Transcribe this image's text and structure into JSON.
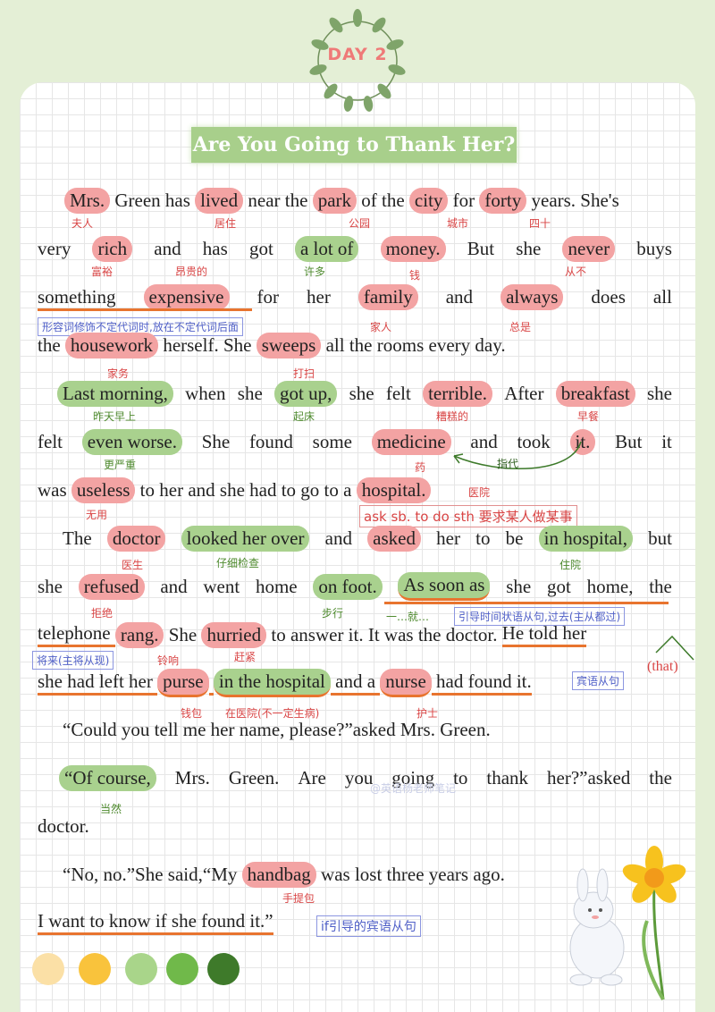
{
  "header": {
    "day": "DAY 2",
    "title": "Are You Going to Thank Her?"
  },
  "paragraphs": {
    "p1": {
      "l1": [
        "Mrs.",
        " Green has ",
        "lived",
        " near the ",
        "park",
        " of the ",
        "city",
        " for ",
        "forty",
        " years. She's"
      ],
      "l2": [
        "very",
        "rich",
        "and",
        "has",
        "got",
        "a lot of",
        "money.",
        "But",
        "she",
        "never",
        "buys"
      ],
      "l3": [
        "something",
        "expensive",
        "for",
        "her",
        "family",
        "and",
        "always",
        "does",
        "all"
      ],
      "l4": [
        "the ",
        "housework",
        " herself. She ",
        "sweeps",
        " all the rooms every day."
      ]
    },
    "p2": {
      "l1": [
        "Last morning,",
        "when",
        "she",
        "got up,",
        "she",
        "felt",
        "terrible.",
        "After",
        "breakfast",
        "she"
      ],
      "l2": [
        "felt",
        "even worse.",
        "She",
        "found",
        "some",
        "medicine",
        "and",
        "took",
        "it.",
        "But",
        "it"
      ],
      "l3": [
        "was ",
        "useless",
        " to her and she had to go to a ",
        "hospital."
      ]
    },
    "p3": {
      "l1": [
        "The",
        "doctor",
        "looked her over",
        "and",
        "asked",
        "her",
        "to",
        "be",
        "in hospital,",
        "but"
      ],
      "l2": [
        "she",
        "refused",
        "and",
        "went",
        "home",
        "on foot.",
        "As soon as",
        "she",
        "got",
        "home,",
        "the"
      ],
      "l3": [
        "telephone ",
        "rang.",
        " She ",
        "hurried",
        " to answer it. It was the doctor. ",
        "He told her"
      ],
      "l4": [
        "she had left her ",
        "purse",
        " ",
        "in the hospital",
        " and a ",
        "nurse",
        " had found it."
      ]
    },
    "p4": {
      "l1": "“Could you tell me her name, please?”asked Mrs. Green."
    },
    "p5": {
      "l1": [
        "“Of course,",
        "Mrs.",
        "Green.",
        "Are",
        "you",
        "going",
        "to",
        "thank",
        "her?”asked",
        "the"
      ],
      "l2": "doctor."
    },
    "p6": {
      "l1": [
        "“No, no.”She said,“My ",
        "handbag",
        " was lost three years ago."
      ],
      "l2": "I want to know if she found it.”"
    }
  },
  "notes": {
    "mrs": "夫人",
    "lived": "居住",
    "park": "公园",
    "city": "城市",
    "forty": "四十",
    "rich": "富裕",
    "expensive": "昂贵的",
    "alotof": "许多",
    "money": "钱",
    "never": "从不",
    "family": "家人",
    "always": "总是",
    "housework": "家务",
    "sweeps": "打扫",
    "last_morning": "昨天早上",
    "got_up": "起床",
    "terrible": "糟糕的",
    "breakfast": "早餐",
    "even_worse": "更严重",
    "medicine": "药",
    "refer": "指代",
    "useless": "无用",
    "hospital": "医院",
    "doctor": "医生",
    "looked_over": "仔细检查",
    "in_hospital": "住院",
    "refused": "拒绝",
    "on_foot": "步行",
    "as_soon_as": "一…就…",
    "rang": "铃响",
    "hurried": "赶紧",
    "purse": "钱包",
    "in_the_hospital": "在医院(不一定生病)",
    "nurse": "护士",
    "of_course": "当然",
    "handbag": "手提包"
  },
  "boxes": {
    "adj_rule": "形容词修饰不定代词时,放在不定代词后面",
    "ask_sb": "ask sb. to do sth 要求某人做某事",
    "time_clause": "引导时间状语从句,过去(主从都过)",
    "future": "将来(主将从现)",
    "object_clause": "宾语从句",
    "if_clause": "if引导的宾语从句",
    "that": "(that)"
  },
  "watermark": "@英语杨老师笔记",
  "colors": {
    "background": "#e4efd6",
    "highlight_pink": "#f3a3a3",
    "highlight_green": "#a9d18e",
    "underline_orange": "#e8742f",
    "palette": [
      "#fbe0a6",
      "#f9c33c",
      "#a9d58a",
      "#70b94a",
      "#3e7a2a"
    ]
  }
}
